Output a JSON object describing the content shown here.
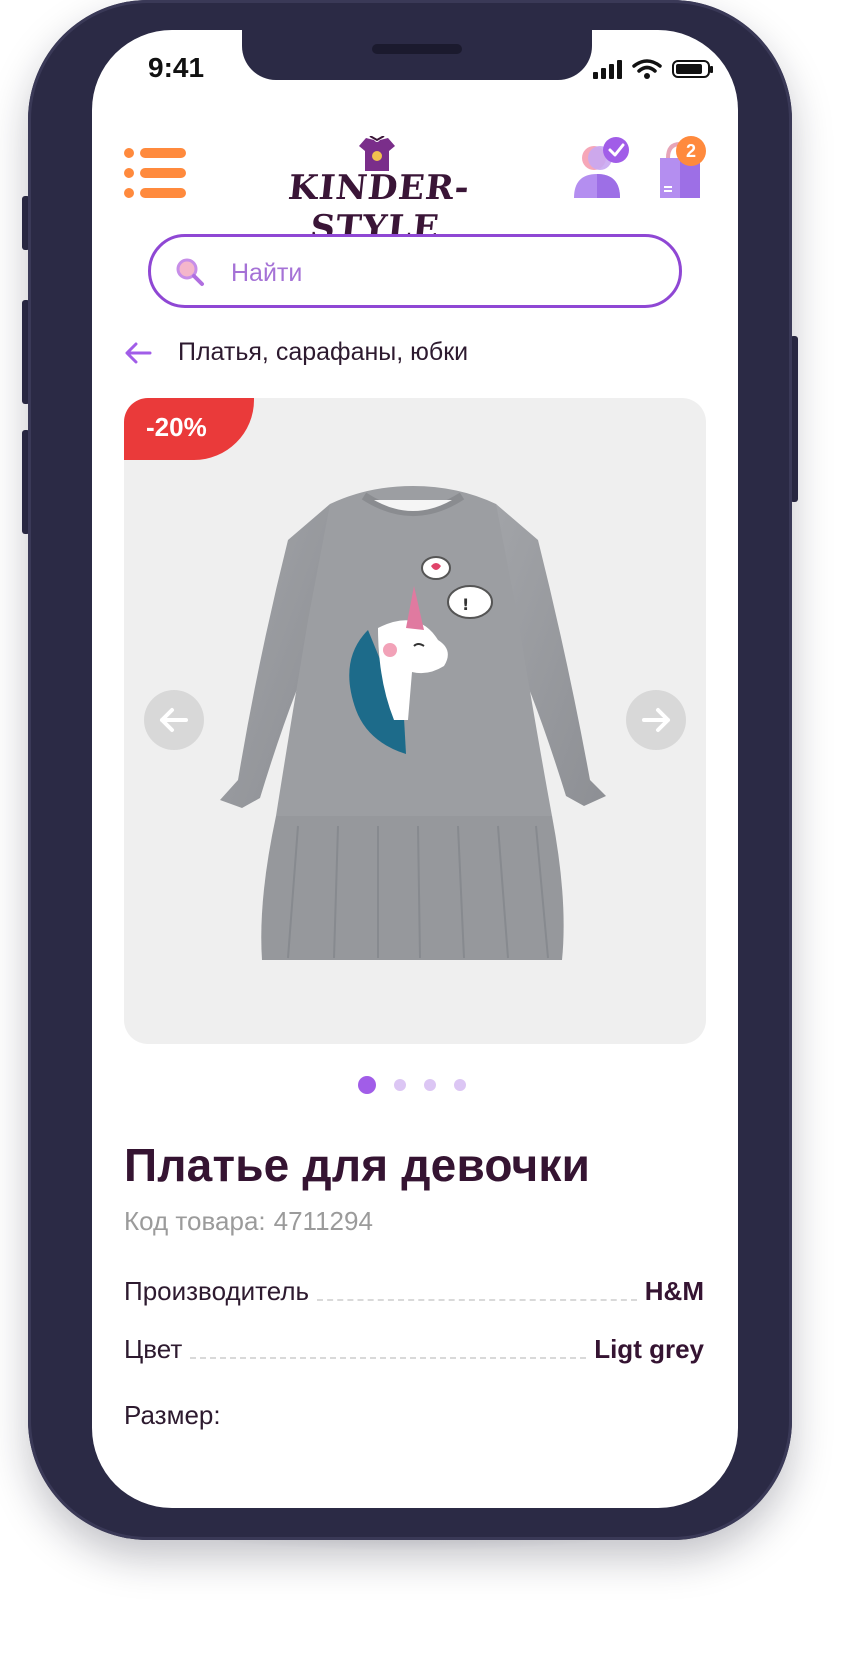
{
  "status_bar": {
    "time": "9:41"
  },
  "header": {
    "logo_text": "KINDER-STYLE",
    "cart_count": "2"
  },
  "search": {
    "placeholder": "Найти"
  },
  "breadcrumb": {
    "label": "Платья, сарафаны, юбки"
  },
  "gallery": {
    "discount": "-20%",
    "slides_total": 4,
    "active_slide": 1
  },
  "product": {
    "title": "Платье для девочки",
    "sku_label": "Код товара:",
    "sku_value": "4711294",
    "specs": [
      {
        "label": "Производитель",
        "value": "H&M"
      },
      {
        "label": "Цвет",
        "value": "Ligt grey"
      }
    ],
    "size_label": "Размер:"
  },
  "colors": {
    "accent_purple": "#8f47d4",
    "accent_orange": "#ff8a3d",
    "discount_red": "#ea3a3a",
    "title_dark": "#351432",
    "phone_frame": "#2b2a45"
  }
}
